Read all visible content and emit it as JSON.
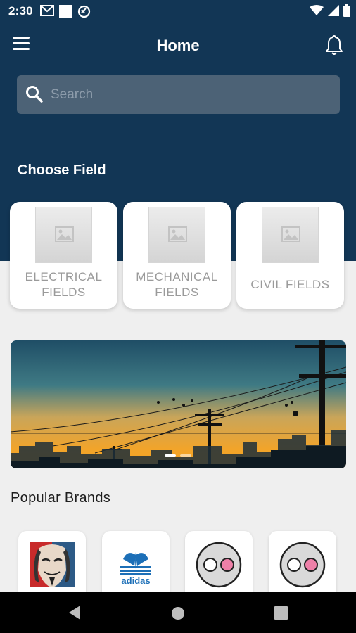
{
  "status_bar": {
    "time": "2:30"
  },
  "header": {
    "title": "Home",
    "menu_icon": "hamburger-menu-icon",
    "notification_icon": "bell-icon"
  },
  "search": {
    "placeholder": "Search",
    "value": ""
  },
  "fields_section": {
    "title": "Choose Field",
    "fields": [
      {
        "label": "ELECTRICAL FIELDS"
      },
      {
        "label": "MECHANICAL FIELDS"
      },
      {
        "label": "CIVIL FIELDS"
      }
    ]
  },
  "banner": {
    "slide_count": 2,
    "active_slide": 1
  },
  "brands_section": {
    "title": "Popular Brands",
    "brands": [
      {
        "name": "anonymous-mask-logo"
      },
      {
        "name": "adidas"
      },
      {
        "name": "flickr-dots-logo"
      },
      {
        "name": "flickr-dots-logo"
      }
    ]
  },
  "colors": {
    "header_bg": "#123655",
    "search_bg": "#4c6276",
    "page_bg": "#efefef",
    "adidas_blue": "#1c6fb7"
  }
}
